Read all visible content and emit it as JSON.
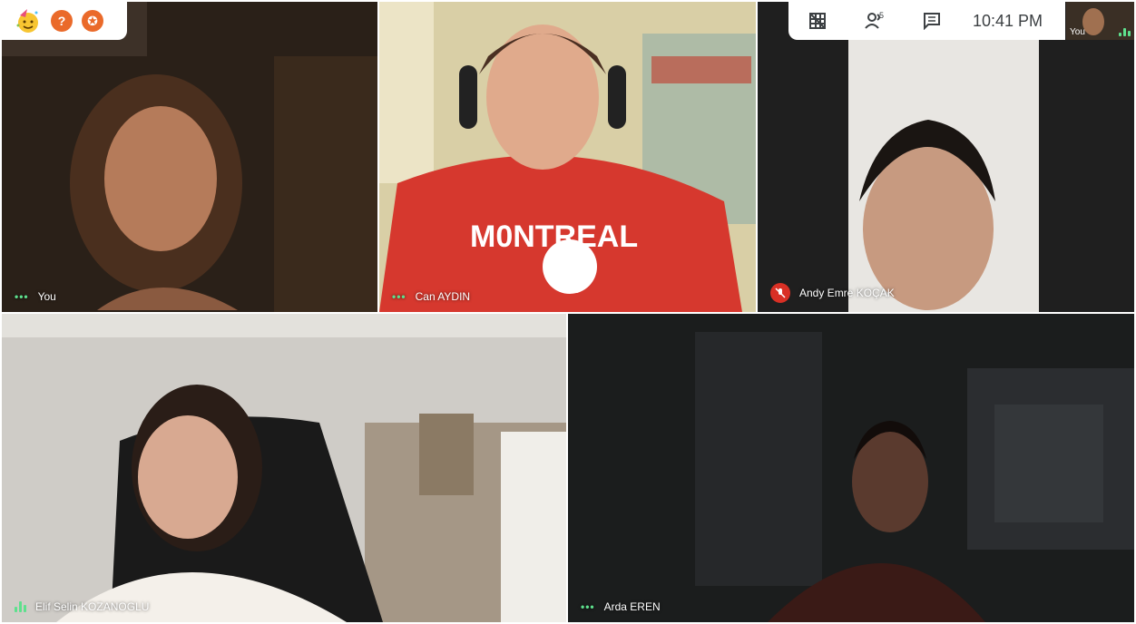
{
  "top_left": {
    "icons": [
      "party-emoji-icon",
      "help-icon",
      "activities-icon"
    ]
  },
  "top_bar": {
    "icons": [
      "tile-layout-icon",
      "people-icon",
      "chat-icon"
    ],
    "people_count": "5",
    "time": "10:41 PM"
  },
  "self_preview": {
    "label": "You"
  },
  "participants": [
    {
      "name": "You",
      "audio": "speaking-dots"
    },
    {
      "name": "Can AYDIN",
      "audio": "speaking-dots"
    },
    {
      "name": "Andy Emre KOÇAK",
      "audio": "muted"
    },
    {
      "name": "Elif Selin KOZANOGLU",
      "audio": "speaking-bars"
    },
    {
      "name": "Arda EREN",
      "audio": "speaking-dots"
    }
  ],
  "colors": {
    "speaking": "#5ee08d",
    "muted": "#d93025",
    "accent": "#ea6a2a"
  }
}
